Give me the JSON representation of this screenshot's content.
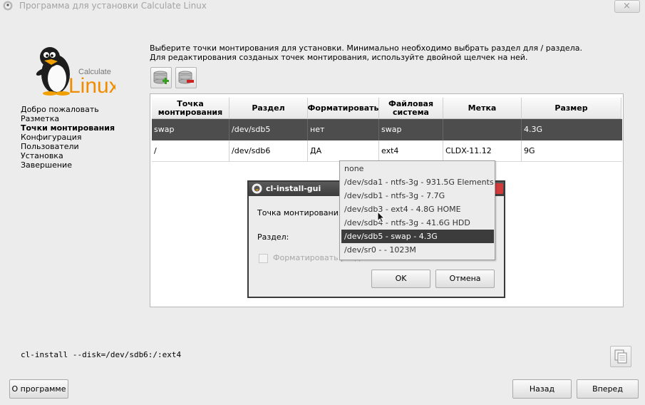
{
  "window": {
    "title": "Программа для установки Calculate Linux",
    "close_label": "×"
  },
  "logo": {
    "small_text": "Calculate",
    "big_text": "Linux"
  },
  "steps": [
    {
      "label": "Добро пожаловать",
      "active": false
    },
    {
      "label": "Разметка",
      "active": false
    },
    {
      "label": "Точки монтирования",
      "active": true
    },
    {
      "label": "Конфигурация",
      "active": false
    },
    {
      "label": "Пользователи",
      "active": false
    },
    {
      "label": "Установка",
      "active": false
    },
    {
      "label": "Завершение",
      "active": false
    }
  ],
  "instructions": {
    "line1": "Выберите точки монтирования для установки. Минимально необходимо выбрать раздел для / раздела.",
    "line2": "Для редактирования созданых точек монтирования, используйте двойной щелчек на ней."
  },
  "toolbar": {
    "add_icon": "disk-add-icon",
    "remove_icon": "disk-remove-icon"
  },
  "table": {
    "headers": [
      {
        "l1": "Точка",
        "l2": "монтирования"
      },
      {
        "l1": "Раздел",
        "l2": ""
      },
      {
        "l1": "Форматировать",
        "l2": ""
      },
      {
        "l1": "Файловая",
        "l2": "система"
      },
      {
        "l1": "Метка",
        "l2": ""
      },
      {
        "l1": "Размер",
        "l2": ""
      }
    ],
    "rows": [
      {
        "mount": "swap",
        "partition": "/dev/sdb5",
        "format": "нет",
        "fs": "swap",
        "label": "",
        "size": "4.3G",
        "selected": true
      },
      {
        "mount": "/",
        "partition": "/dev/sdb6",
        "format": "ДА",
        "fs": "ext4",
        "label": "CLDX-11.12",
        "size": "9G",
        "selected": false
      }
    ]
  },
  "dialog": {
    "title": "cl-install-gui",
    "mount_label": "Точка монтирования:",
    "partition_label": "Раздел:",
    "format_label": "Форматировать раздел",
    "format_checked": false,
    "ok_label": "OK",
    "cancel_label": "Отмена"
  },
  "dropdown": {
    "options": [
      "none",
      "/dev/sda1 - ntfs-3g - 931.5G Elements",
      "/dev/sdb1 - ntfs-3g - 7.7G",
      "/dev/sdb3 - ext4 - 4.8G HOME",
      "/dev/sdb4 - ntfs-3g - 41.6G HDD",
      "/dev/sdb5 - swap - 4.3G",
      "/dev/sr0 -  - 1023M"
    ],
    "selected_index": 5
  },
  "command": "cl-install --disk=/dev/sdb6:/:ext4",
  "buttons": {
    "about": "О программе",
    "back": "Назад",
    "next": "Вперед"
  },
  "colors": {
    "selected_row": "#4d4d4d",
    "dialog_title_bar": "#3c3c3c",
    "logo_orange": "#f08c00"
  }
}
